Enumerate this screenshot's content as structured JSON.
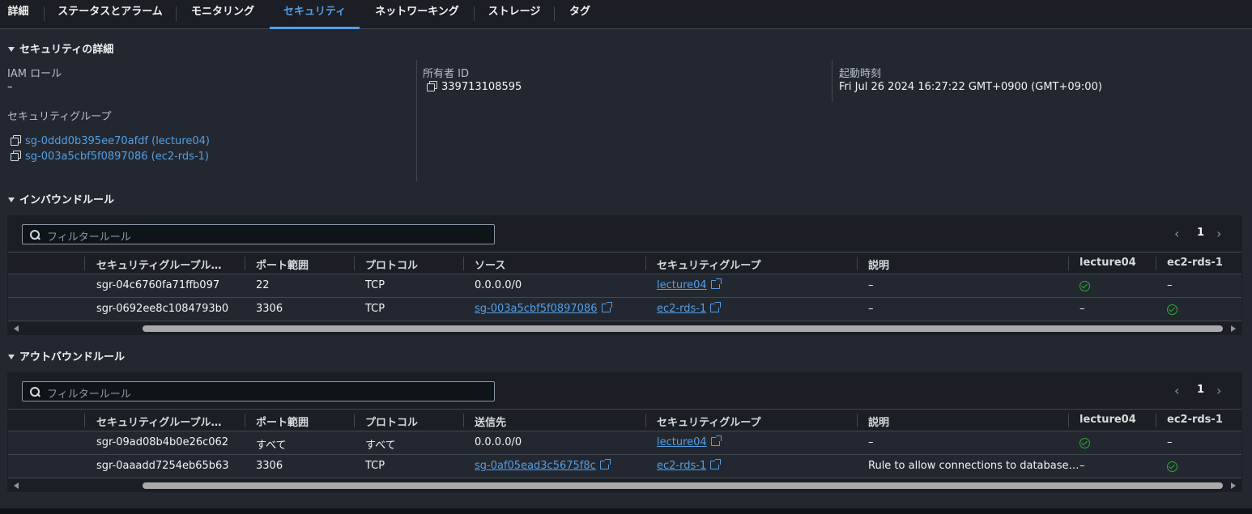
{
  "tabs": [
    {
      "label": "詳細"
    },
    {
      "label": "ステータスとアラーム"
    },
    {
      "label": "モニタリング"
    },
    {
      "label": "セキュリティ"
    },
    {
      "label": "ネットワーキング"
    },
    {
      "label": "ストレージ"
    },
    {
      "label": "タグ"
    }
  ],
  "active_tab": "セキュリティ",
  "security_details": {
    "title": "セキュリティの詳細",
    "iam_role_label": "IAM ロール",
    "iam_role_value": "–",
    "sg_label": "セキュリティグループ",
    "security_groups": [
      "sg-0ddd0b395ee70afdf (lecture04)",
      "sg-003a5cbf5f0897086 (ec2-rds-1)"
    ],
    "owner_label": "所有者 ID",
    "owner_value": "339713108595",
    "launch_label": "起動時刻",
    "launch_value": "Fri Jul 26 2024 16:27:22 GMT+0900 (GMT+09:00)"
  },
  "inbound": {
    "title": "インバウンドルール",
    "filter_placeholder": "フィルタールール",
    "page": "1",
    "columns": [
      "セキュリティグループル…",
      "ポート範囲",
      "プロトコル",
      "ソース",
      "セキュリティグループ",
      "説明",
      "lecture04",
      "ec2-rds-1"
    ],
    "rows": [
      {
        "rule_id": "sgr-04c6760fa71ffb097",
        "port": "22",
        "protocol": "TCP",
        "source": "0.0.0.0/0",
        "source_is_link": false,
        "sg": "lecture04",
        "desc": "–",
        "lecture04": "check",
        "ec2rds1": "–"
      },
      {
        "rule_id": "sgr-0692ee8c1084793b0",
        "port": "3306",
        "protocol": "TCP",
        "source": "sg-003a5cbf5f0897086",
        "source_is_link": true,
        "sg": "ec2-rds-1",
        "desc": "–",
        "lecture04": "–",
        "ec2rds1": "check"
      }
    ]
  },
  "outbound": {
    "title": "アウトバウンドルール",
    "filter_placeholder": "フィルタールール",
    "page": "1",
    "columns": [
      "セキュリティグループル…",
      "ポート範囲",
      "プロトコル",
      "送信先",
      "セキュリティグループ",
      "説明",
      "lecture04",
      "ec2-rds-1"
    ],
    "rows": [
      {
        "rule_id": "sgr-09ad08b4b0e26c062",
        "port": "すべて",
        "protocol": "すべて",
        "source": "0.0.0.0/0",
        "source_is_link": false,
        "sg": "lecture04",
        "desc": "–",
        "lecture04": "check",
        "ec2rds1": "–"
      },
      {
        "rule_id": "sgr-0aaadd7254eb65b63",
        "port": "3306",
        "protocol": "TCP",
        "source": "sg-0af05ead3c5675f8c",
        "source_is_link": true,
        "sg": "ec2-rds-1",
        "desc": "Rule to allow connections to database…",
        "lecture04": "–",
        "ec2rds1": "check"
      }
    ]
  },
  "colors": {
    "link": "#539fe5",
    "check": "#29ad32",
    "panel_bg": "#232830",
    "page_bg": "#1b1e24"
  }
}
